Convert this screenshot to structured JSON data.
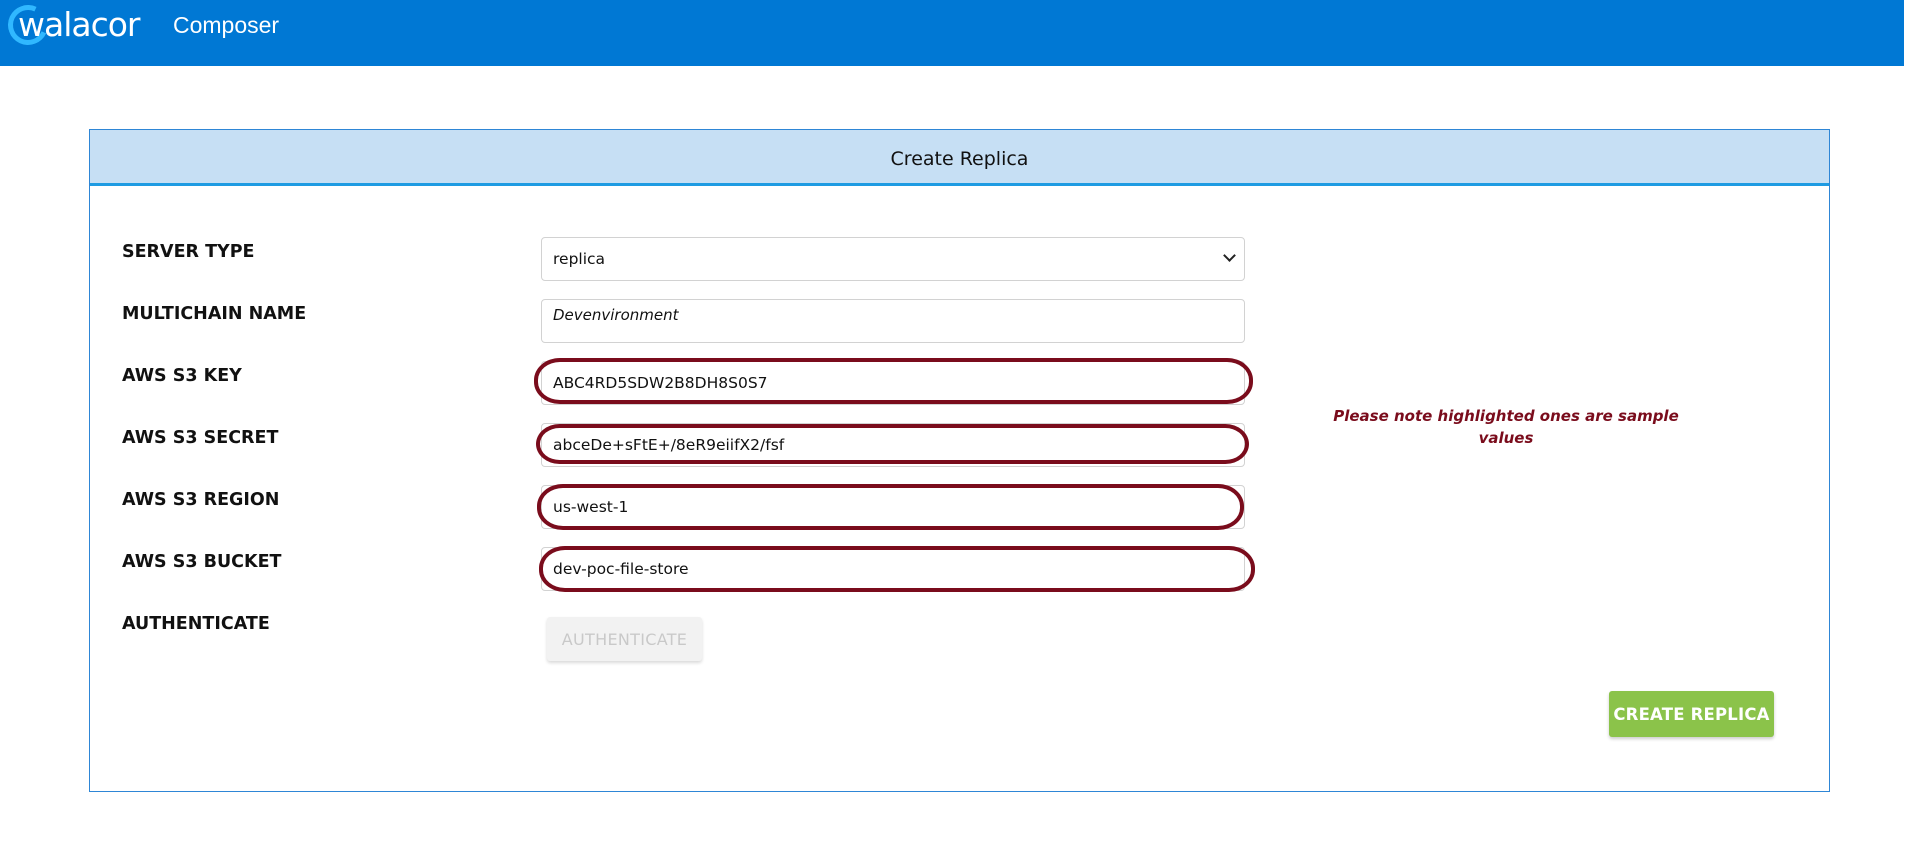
{
  "header": {
    "logo_text": "walacor",
    "app_name": "Composer"
  },
  "panel": {
    "title": "Create Replica"
  },
  "form": {
    "server_type": {
      "label": "SERVER TYPE",
      "value": "replica"
    },
    "multichain_name": {
      "label": "MULTICHAIN NAME",
      "value": "Devenvironment"
    },
    "aws_s3_key": {
      "label": "AWS S3 KEY",
      "value": "ABC4RD5SDW2B8DH8S0S7"
    },
    "aws_s3_secret": {
      "label": "AWS S3 SECRET",
      "value": "abceDe+sFtE+/8eR9eiifX2/fsf"
    },
    "aws_s3_region": {
      "label": "AWS S3 REGION",
      "value": "us-west-1"
    },
    "aws_s3_bucket": {
      "label": "AWS S3 BUCKET",
      "value": "dev-poc-file-store"
    },
    "authenticate": {
      "label": "AUTHENTICATE",
      "button_label": "AUTHENTICATE"
    }
  },
  "note": "Please note highlighted ones are sample values",
  "actions": {
    "create_label": "CREATE REPLICA"
  },
  "colors": {
    "header_bg": "#0078d4",
    "panel_header_bg": "#c6dff4",
    "highlight": "#7a0c1c",
    "create_button": "#8bc34a"
  }
}
